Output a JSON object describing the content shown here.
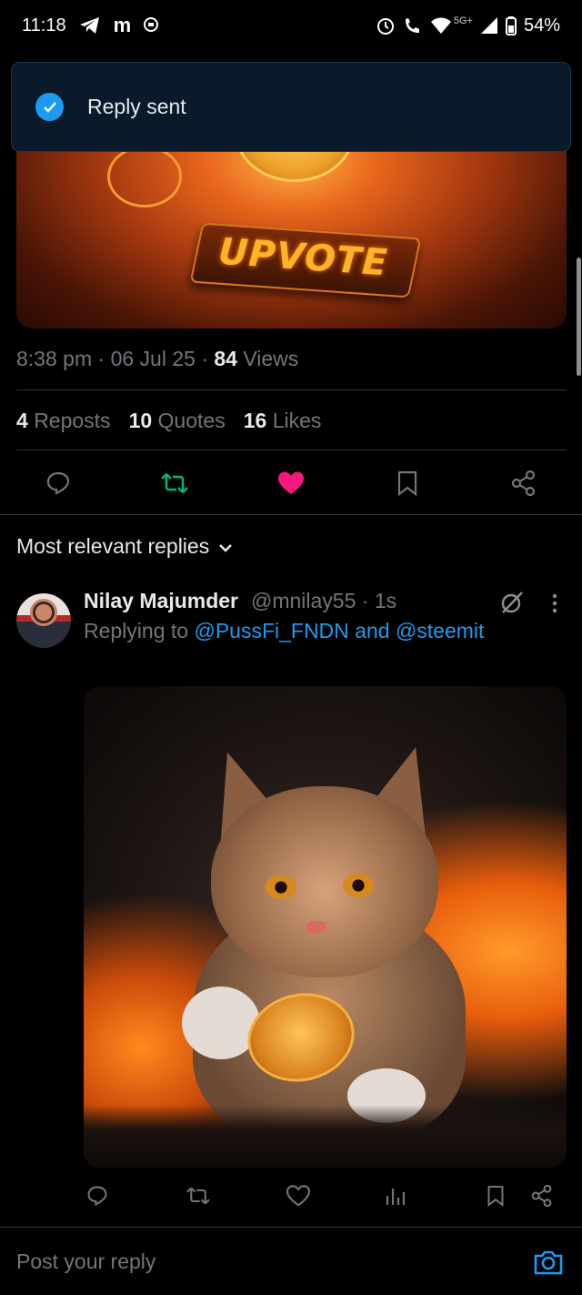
{
  "status_bar": {
    "time": "11:18",
    "network": "5G+",
    "battery": "54%",
    "left_icons": [
      "telegram-icon",
      "m-app-icon",
      "chat-app-icon"
    ],
    "right_icons": [
      "alarm-icon",
      "wifi-calling-icon",
      "wifi-icon",
      "signal-icon",
      "battery-icon"
    ]
  },
  "toast": {
    "message": "Reply sent",
    "icon": "check-circle-icon",
    "accent": "#1d9bf0"
  },
  "post": {
    "media_caption_text": "UPVOTE",
    "time": "8:38 pm",
    "date": "06 Jul 25",
    "views_count": "84",
    "views_label": "Views",
    "reposts_count": "4",
    "reposts_label": "Reposts",
    "quotes_count": "10",
    "quotes_label": "Quotes",
    "likes_count": "16",
    "likes_label": "Likes",
    "actions": [
      "reply-icon",
      "repost-icon",
      "like-icon",
      "bookmark-icon",
      "share-icon"
    ],
    "repost_color": "#00ba7c",
    "like_color": "#f91880"
  },
  "replies": {
    "sort_label": "Most relevant replies",
    "items": [
      {
        "name": "Nilay Majumder",
        "handle": "@mnilay55",
        "time": "1s",
        "replying_prefix": "Replying to",
        "replying_targets": "@PussFi_FNDN and @steemit",
        "actions": [
          "reply-icon",
          "repost-icon",
          "like-icon",
          "analytics-icon",
          "bookmark-icon",
          "share-icon"
        ]
      }
    ]
  },
  "composer": {
    "placeholder": "Post your reply",
    "icon": "camera-icon"
  }
}
